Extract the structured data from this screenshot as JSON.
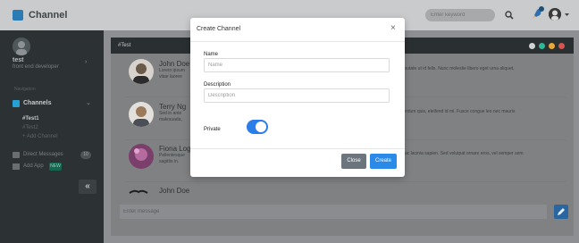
{
  "app": {
    "title": "Channel"
  },
  "topbar": {
    "search_placeholder": "Enter keyword"
  },
  "sidebar": {
    "user_name": "test",
    "user_role": "front end developer",
    "nav_heading": "Navigation",
    "channels_label": "Channels",
    "channel_items": [
      "#Test1",
      "#Test2",
      "+ Add Channel"
    ],
    "direct_messages_label": "Direct Messages",
    "direct_messages_badge": "10",
    "add_app_label": "Add App",
    "add_app_badge": "NEW",
    "collapse_symbol": "«"
  },
  "channel": {
    "name": "#Test",
    "messages": [
      {
        "name": "John Doe",
        "text_left": "Lorem ipsum vitae laoree",
        "text_right": "vulputate ut id felis. Nunc molestie libero eget urna aliquet,"
      },
      {
        "name": "Terry Ng",
        "text_left": "Sed in ante malesuada,",
        "text_right": "interdum quis, eleifend id mi. Fusce congue leo nec mauris"
      },
      {
        "name": "Fiona Log",
        "text_left": "Pellentesque sagittis in.",
        "text_right": "at, ac lacinia sapien. Sed volutpat ornare eros, vel semper sem"
      },
      {
        "name": "John Doe",
        "text_left": "",
        "text_right": ""
      }
    ],
    "input_placeholder": "Enter message"
  },
  "modal": {
    "title": "Create Channel",
    "close_symbol": "×",
    "name_label": "Name",
    "name_placeholder": "Name",
    "description_label": "Description",
    "description_placeholder": "Description",
    "private_label": "Private",
    "private_enabled": true,
    "close_button": "Close",
    "create_button": "Create"
  },
  "colors": {
    "accent": "#2b7de9",
    "create_button": "#2b8ae8",
    "close_button": "#6c757d",
    "sidebar_bg": "#2c3133",
    "header_dots": [
      "#3b8fd0",
      "#2db89a",
      "#e5a93a",
      "#d9534f"
    ]
  },
  "icons": [
    "channel-logo-icon",
    "search-icon",
    "rocket-icon",
    "caret-down-icon",
    "send-icon",
    "close-icon"
  ]
}
